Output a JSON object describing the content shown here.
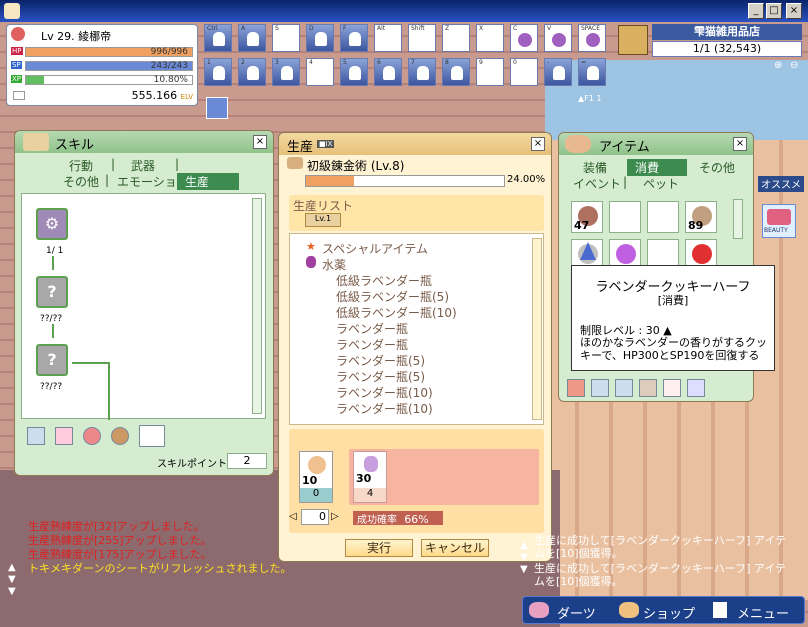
{
  "status": {
    "level": "Lv 29.",
    "name": "綾梛帝",
    "hp_label": "HP",
    "hp": "996/996",
    "hp_ratio": 1.0,
    "sp_label": "SP",
    "sp": "243/243",
    "sp_ratio": 1.0,
    "xp_label": "XP",
    "xp": "10.80%",
    "xp_ratio": 0.108,
    "money": "555.166",
    "money_unit": "ELV"
  },
  "hotkeys": {
    "row1": [
      "Ctrl",
      "A",
      "S",
      "D",
      "F",
      "Alt",
      "Shift",
      "Z",
      "X",
      "C",
      "V",
      "SPACE"
    ],
    "row2": [
      "1",
      "2",
      "3",
      "4",
      "5",
      "6",
      "7",
      "8",
      "9",
      "0",
      "-",
      "="
    ],
    "page": "F1",
    "page_num": "1",
    "colors": {
      "skill": "#3c56a0",
      "item": "#a060c0"
    }
  },
  "shop": {
    "name": "雫猫雑用品店",
    "count": "1/1 (32,543)"
  },
  "skill": {
    "title": "スキル",
    "tabs": [
      "行動",
      "武器",
      "その他",
      "エモーション",
      "生産"
    ],
    "sep": "|",
    "active_tab": "生産",
    "nodes": [
      {
        "label": "1/ 1"
      },
      {
        "label": "??/??"
      },
      {
        "label": "??/??"
      }
    ],
    "points_label": "スキルポイント",
    "points": "2"
  },
  "production": {
    "title": "生産",
    "badge": "■IX",
    "skill_name": "初級錬金術 (Lv.8)",
    "progress": "24.00%",
    "progress_ratio": 0.24,
    "list_label": "生産リスト",
    "level_tag": "Lv.1",
    "categories": [
      "スペシャルアイテム",
      "水薬"
    ],
    "recipes": [
      "低級ラベンダー瓶",
      "低級ラベンダー瓶(5)",
      "低級ラベンダー瓶(10)",
      "ラベンダー瓶",
      "ラベンダー瓶",
      "ラベンダー瓶(5)",
      "ラベンダー瓶(5)",
      "ラベンダー瓶(10)",
      "ラベンダー瓶(10)"
    ],
    "material_count": "10",
    "material_have": "0",
    "result_count": "30",
    "result_need": "4",
    "quantity": "0",
    "success_label": "成功確率",
    "success_value": "66",
    "success_unit": "%",
    "run": "実行",
    "cancel": "キャンセル"
  },
  "item": {
    "title": "アイテム",
    "tabs_row1": [
      "装備",
      "消費",
      "その他"
    ],
    "tabs_row2": [
      "イベント",
      "ペット"
    ],
    "sep": "|",
    "active_tab": "消費",
    "slots": [
      "47",
      "",
      "",
      "89",
      "",
      "",
      "",
      ""
    ]
  },
  "tooltip": {
    "name": "ラベンダークッキーハーフ",
    "type": "[消費]",
    "level": "制限レベル : 30 ▲",
    "desc": "ほのかなラベンダーの香りがするクッキーで、HP300とSP190を回復する"
  },
  "side": {
    "osusume": "オススメ",
    "beauty": "BEAUTY"
  },
  "chat": [
    "生産熟練度が[32]アップしました。",
    "生産熟練度が[255]アップしました。",
    "生産熟練度が[175]アップしました。",
    "トキメキダーンのシートがリフレッシュされました。"
  ],
  "chat_right": [
    "生産に成功して[ラベンダークッキーハーフ] アイテムを[10]個獲得。",
    "生産に成功して[ラベンダークッキーハーフ] アイテムを[10]個獲得。"
  ],
  "menu": {
    "darts": "ダーツ",
    "shop": "ショップ",
    "menu": "メニュー"
  }
}
